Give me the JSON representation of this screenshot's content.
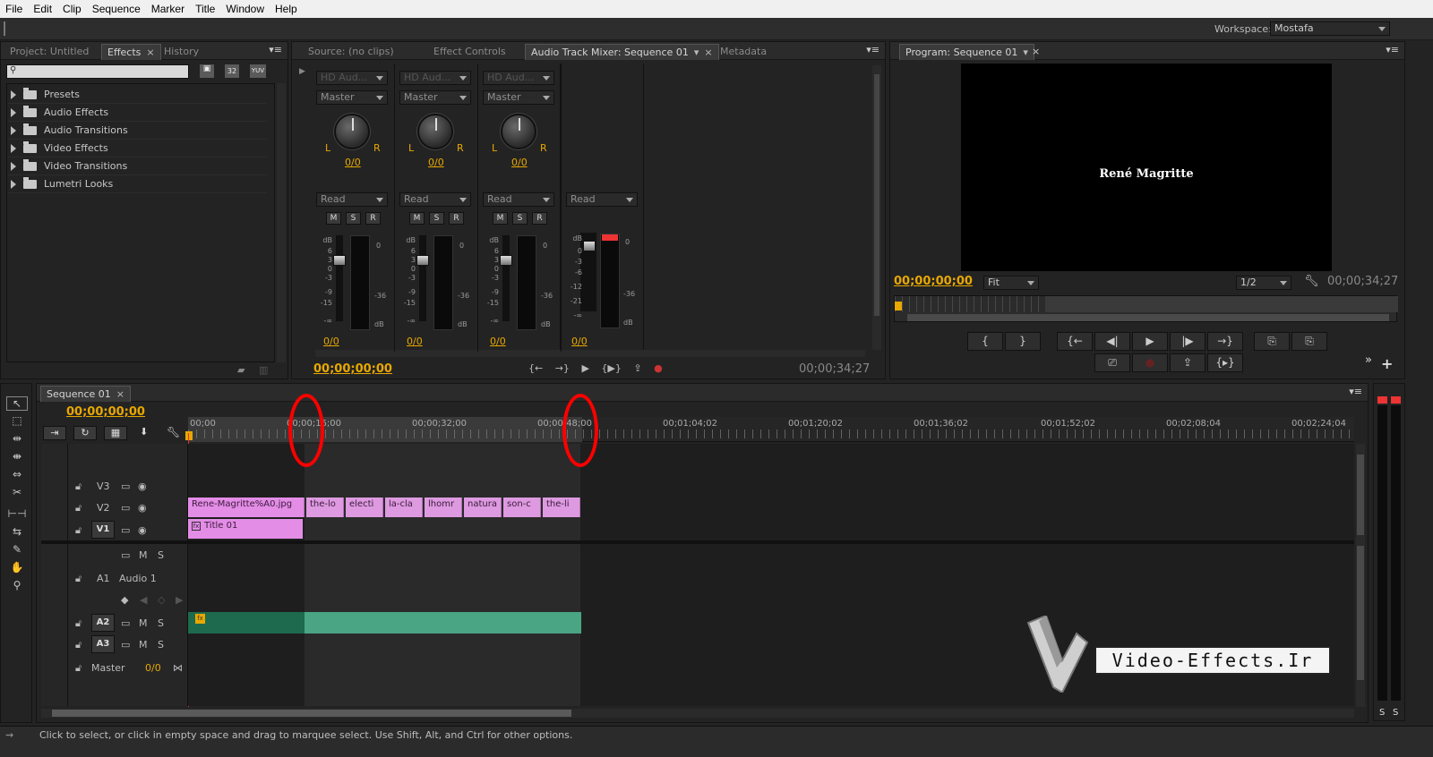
{
  "menu": [
    "File",
    "Edit",
    "Clip",
    "Sequence",
    "Marker",
    "Title",
    "Window",
    "Help"
  ],
  "workspace": {
    "label": "Workspace:",
    "value": "Mostafa"
  },
  "effects_panel": {
    "tabs": [
      "Project: Untitled",
      "Effects",
      "History"
    ],
    "close": "×",
    "badges": [
      "32",
      "YUV"
    ],
    "items": [
      "Presets",
      "Audio Effects",
      "Audio Transitions",
      "Video Effects",
      "Video Transitions",
      "Lumetri Looks"
    ]
  },
  "mixer_panel": {
    "tabs": [
      "Source: (no clips)",
      "Effect Controls",
      "Audio Track Mixer: Sequence 01",
      "Metadata"
    ],
    "close": "×",
    "channels": [
      {
        "input": "HD Aud...",
        "output": "Master",
        "L": "L",
        "R": "R",
        "pan": "0/0",
        "mode": "Read",
        "level": "0/0"
      },
      {
        "input": "HD Aud...",
        "output": "Master",
        "L": "L",
        "R": "R",
        "pan": "0/0",
        "mode": "Read",
        "level": "0/0"
      },
      {
        "input": "HD Aud...",
        "output": "Master",
        "L": "L",
        "R": "R",
        "pan": "0/0",
        "mode": "Read",
        "level": "0/0"
      },
      {
        "mode": "Read",
        "level": "0/0"
      }
    ],
    "msr": [
      "M",
      "S",
      "R"
    ],
    "db_scale": [
      "dB",
      "6",
      "3",
      "0",
      "-3",
      "-9",
      "-15",
      "-∞"
    ],
    "master_scale": [
      "dB",
      "0",
      "-3",
      "-6",
      "-12",
      "-21",
      "-∞"
    ],
    "meter_top": "0",
    "meter_mid": "-36",
    "meter_bot": "dB",
    "timecode": "00;00;00;00",
    "duration": "00;00;34;27",
    "transport": [
      "{←",
      "→}",
      "▶",
      "{▶}",
      "⇪",
      "●"
    ]
  },
  "program_monitor": {
    "tab": "Program: Sequence 01",
    "close": "×",
    "video_text": "René Magritte",
    "timecode": "00;00;00;00",
    "fit": "Fit",
    "resolution": "1/2",
    "duration": "00;00;34;27",
    "buttons_row1": [
      "{",
      "}",
      "{←",
      "◀|",
      "▶",
      "|▶",
      "→}",
      "⎘",
      "⎘"
    ],
    "buttons_row2": [
      "⎚",
      "●",
      "⇪",
      "{▸}"
    ],
    "more": "»",
    "add": "+"
  },
  "timeline": {
    "tab": "Sequence 01",
    "close": "×",
    "timecode": "00;00;00;00",
    "ruler": [
      "00;00",
      "00;00;16;00",
      "00;00;32;00",
      "00;00;48;00",
      "00;01;04;02",
      "00;01;20;02",
      "00;01;36;02",
      "00;01;52;02",
      "00;02;08;04",
      "00;02;24;04"
    ],
    "tracks": {
      "v3": "V3",
      "v2": "V2",
      "v1": "V1",
      "a1": "A1",
      "a1_name": "Audio 1",
      "a2": "A2",
      "a3": "A3",
      "master": "Master",
      "master_level": "0/0",
      "m": "M",
      "s": "S"
    },
    "clips_v2": [
      "Rene-Magritte%A0.jpg",
      "the-lo",
      "electi",
      "la-cla",
      "lhomr",
      "natura",
      "son-c",
      "the-li"
    ],
    "clip_v1": "Title 01",
    "fx": "fx"
  },
  "watermark": "Video-Effects.Ir",
  "meter_right": {
    "s1": "S",
    "s2": "S"
  },
  "status_text": "Click to select, or click in empty space and drag to marquee select. Use Shift, Alt, and Ctrl for other options.",
  "colors": {
    "accent": "#e8a800",
    "clip_video": "#e38de6",
    "clip_audio": "#4aa584",
    "playhead": "#e03030",
    "annotation": "#ff0000"
  }
}
